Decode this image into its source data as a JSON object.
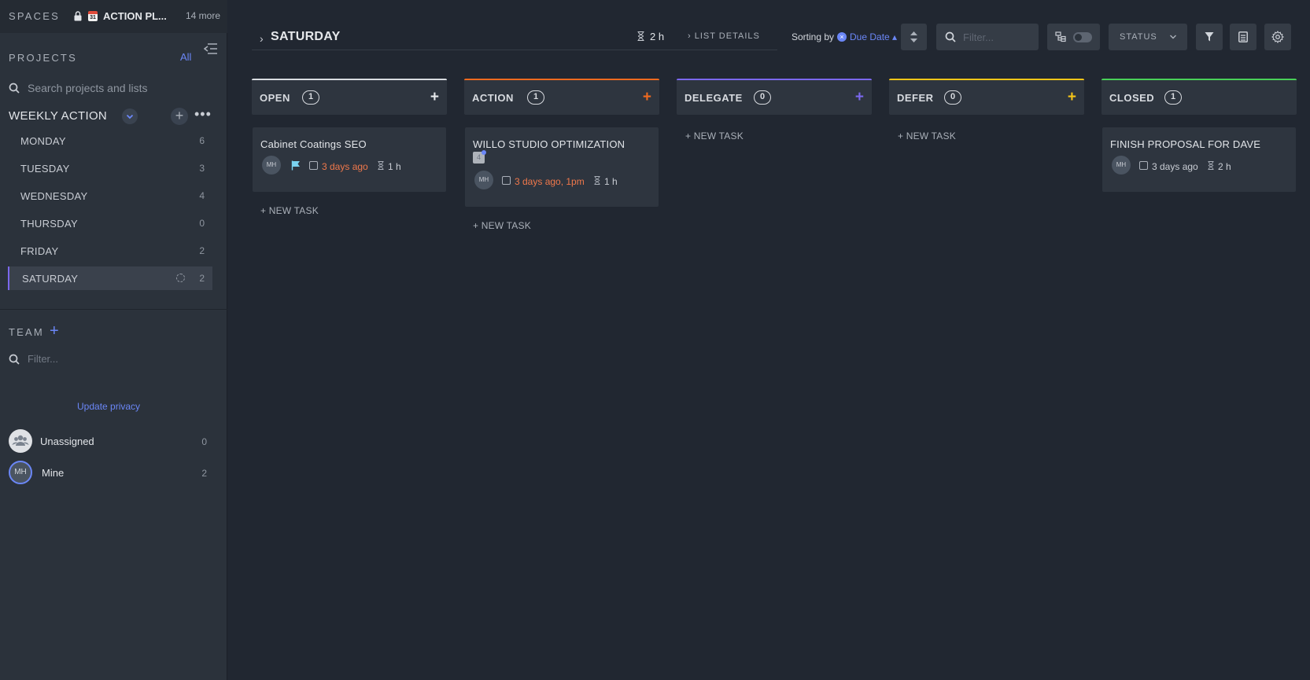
{
  "sidebar": {
    "spaces_label": "SPACES",
    "space_name": "ACTION PL...",
    "calendar_mini": "31",
    "more_label": "14 more",
    "projects_label": "PROJECTS",
    "all_label": "All",
    "search_placeholder": "Search projects and lists",
    "folder_name": "WEEKLY ACTION",
    "folder_more": "•••",
    "folder_add": "+",
    "lists": [
      {
        "label": "MONDAY",
        "count": "6"
      },
      {
        "label": "TUESDAY",
        "count": "3"
      },
      {
        "label": "WEDNESDAY",
        "count": "4"
      },
      {
        "label": "THURSDAY",
        "count": "0"
      },
      {
        "label": "FRIDAY",
        "count": "2"
      },
      {
        "label": "SATURDAY",
        "count": "2"
      }
    ],
    "team_label": "TEAM",
    "team_add": "+",
    "team_filter_placeholder": "Filter...",
    "privacy_link": "Update privacy",
    "users": [
      {
        "name": "Unassigned",
        "count": "0"
      },
      {
        "name": "Mine",
        "count": "2",
        "initials": "MH"
      }
    ]
  },
  "header": {
    "breadcrumb_chevron": "›",
    "title": "SATURDAY",
    "time_total": "2 h",
    "list_details": "› LIST DETAILS",
    "sorting_label": "Sorting by",
    "sort_clear": "×",
    "sort_value": "Due Date ▴",
    "filter_placeholder": "Filter...",
    "status_button": "STATUS"
  },
  "columns": [
    {
      "title": "OPEN",
      "count": "1",
      "add": "+",
      "new_task": "+ NEW TASK",
      "color": "#d8dbe0"
    },
    {
      "title": "ACTION",
      "count": "1",
      "add": "+",
      "new_task": "+ NEW TASK",
      "color": "#f06a1f"
    },
    {
      "title": "DELEGATE",
      "count": "0",
      "add": "+",
      "new_task": "+ NEW TASK",
      "color": "#7b68ee"
    },
    {
      "title": "DEFER",
      "count": "0",
      "add": "+",
      "new_task": "+ NEW TASK",
      "color": "#f5c518"
    },
    {
      "title": "CLOSED",
      "count": "1",
      "add": "+",
      "new_task": "",
      "color": "#49d058"
    }
  ],
  "cards": {
    "open": {
      "title": "Cabinet Coatings SEO",
      "assignee": "MH",
      "due": "3 days ago",
      "estimate": "1 h"
    },
    "action": {
      "title": "WILLO STUDIO OPTIMIZATION",
      "doc_badge": "4",
      "assignee": "MH",
      "due": "3 days ago, 1pm",
      "estimate": "1 h"
    },
    "closed": {
      "title": "FINISH PROPOSAL FOR DAVE",
      "assignee": "MH",
      "due": "3 days ago",
      "estimate": "2 h"
    }
  },
  "colors": {
    "accent": "#6b87f7",
    "overdue": "#f0784b",
    "priority_flag": "#7ad3f0"
  }
}
